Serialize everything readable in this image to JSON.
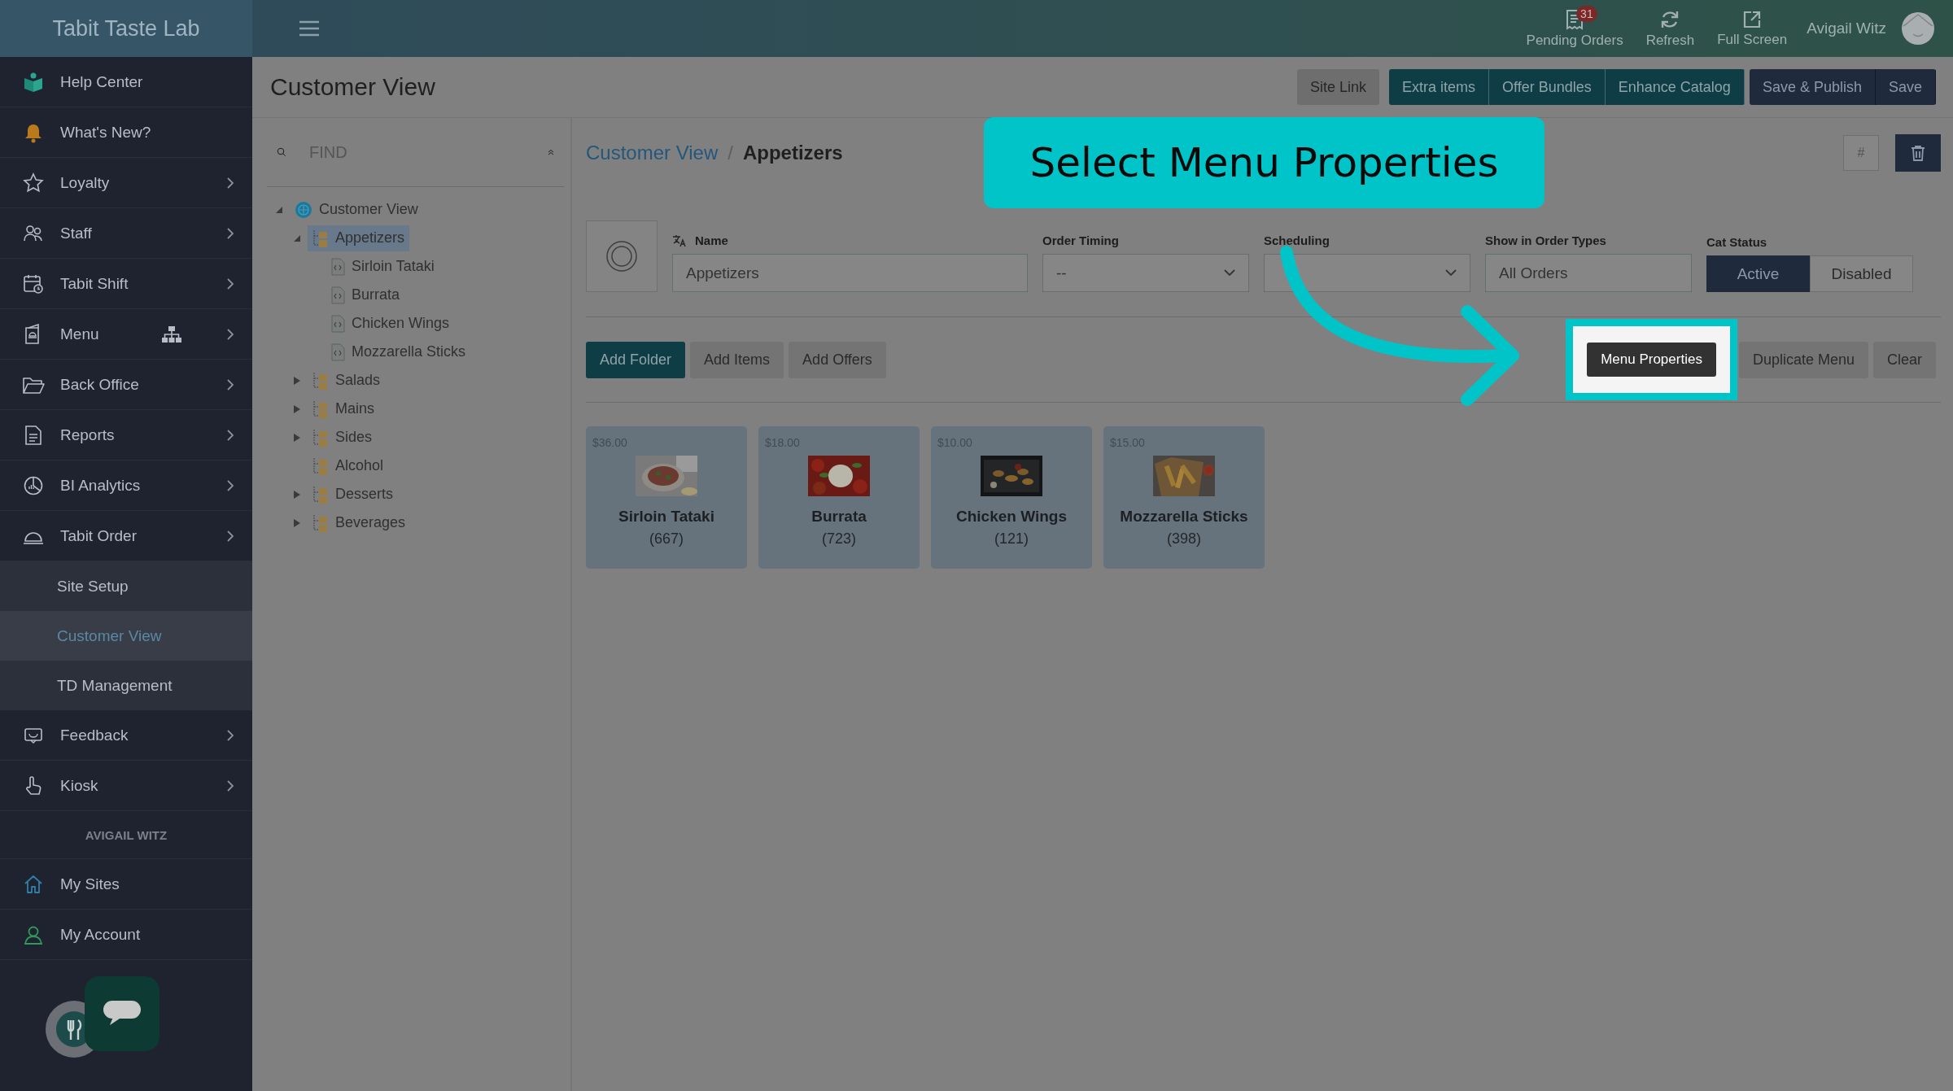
{
  "app": {
    "title": "Tabit Taste Lab"
  },
  "sidebar": {
    "items": [
      {
        "kind": "item",
        "label": "Help Center",
        "submenu": false
      },
      {
        "kind": "item",
        "label": "What's New?",
        "submenu": false
      },
      {
        "kind": "item",
        "label": "Loyalty",
        "submenu": true
      },
      {
        "kind": "item",
        "label": "Staff",
        "submenu": true
      },
      {
        "kind": "item",
        "label": "Tabit Shift",
        "submenu": true
      },
      {
        "kind": "item",
        "label": "Menu",
        "submenu": true
      },
      {
        "kind": "item",
        "label": "Back Office",
        "submenu": true
      },
      {
        "kind": "item",
        "label": "Reports",
        "submenu": true
      },
      {
        "kind": "item",
        "label": "BI Analytics",
        "submenu": true
      },
      {
        "kind": "item",
        "label": "Tabit Order",
        "submenu": true
      },
      {
        "kind": "subitem",
        "label": "Site Setup",
        "selected": false
      },
      {
        "kind": "subitem",
        "label": "Customer View",
        "selected": true
      },
      {
        "kind": "subitem",
        "label": "TD Management",
        "selected": false
      },
      {
        "kind": "item",
        "label": "Feedback",
        "submenu": true
      },
      {
        "kind": "item",
        "label": "Kiosk",
        "submenu": true
      },
      {
        "kind": "heading",
        "label": "AVIGAIL WITZ"
      },
      {
        "kind": "item",
        "label": "My Sites",
        "submenu": false
      },
      {
        "kind": "item",
        "label": "My Account",
        "submenu": false
      }
    ]
  },
  "topbar": {
    "actions": [
      {
        "label": "Pending Orders",
        "badge": "31"
      },
      {
        "label": "Refresh"
      },
      {
        "label": "Full Screen"
      }
    ],
    "user": "Avigail Witz"
  },
  "header": {
    "title": "Customer View",
    "buttons": [
      {
        "label": "Site Link",
        "kind": "plain"
      },
      {
        "label": "Extra items",
        "kind": "teal"
      },
      {
        "label": "Offer Bundles",
        "kind": "teal"
      },
      {
        "label": "Enhance Catalog",
        "kind": "teal"
      },
      {
        "label": "Save & Publish",
        "kind": "dark"
      },
      {
        "label": "Save",
        "kind": "dark"
      }
    ]
  },
  "tree": {
    "placeholder": "FIND",
    "nodes": [
      {
        "kind": "root",
        "label": "Customer View",
        "expanded": true,
        "selected": false,
        "children": [
          {
            "kind": "folder",
            "label": "Appetizers",
            "expanded": true,
            "selected": true,
            "children": [
              {
                "kind": "item",
                "label": "Sirloin Tataki",
                "selected": false
              },
              {
                "kind": "item",
                "label": "Burrata",
                "selected": false
              },
              {
                "kind": "item",
                "label": "Chicken Wings",
                "selected": false
              },
              {
                "kind": "item",
                "label": "Mozzarella Sticks",
                "selected": false
              }
            ]
          },
          {
            "kind": "folder",
            "label": "Salads",
            "expanded": false,
            "selected": false
          },
          {
            "kind": "folder",
            "label": "Mains",
            "expanded": false,
            "selected": false
          },
          {
            "kind": "folder",
            "label": "Sides",
            "expanded": false,
            "selected": false
          },
          {
            "kind": "folder",
            "label": "Alcohol",
            "selected": false
          },
          {
            "kind": "folder",
            "label": "Desserts",
            "expanded": false,
            "selected": false
          },
          {
            "kind": "folder",
            "label": "Beverages",
            "expanded": false,
            "selected": false
          }
        ]
      }
    ]
  },
  "breadcrumb": {
    "items": [
      "Customer View",
      "Appetizers"
    ],
    "separator": "/"
  },
  "hash_button": "#",
  "form": {
    "fields": [
      {
        "kind": "text",
        "label": "Name",
        "value": "Appetizers"
      },
      {
        "kind": "select",
        "label": "Order Timing",
        "value": "--"
      },
      {
        "kind": "select",
        "label": "Scheduling"
      },
      {
        "kind": "text",
        "label": "Show in Order Types",
        "value": "All Orders"
      },
      {
        "kind": "toggle",
        "label": "Cat Status",
        "options": [
          {
            "label": "Active",
            "selected": true
          },
          {
            "label": "Disabled",
            "selected": false
          }
        ]
      }
    ]
  },
  "actions_left": [
    {
      "label": "Add Folder",
      "kind": "primary"
    },
    {
      "label": "Add Items",
      "kind": "plain"
    },
    {
      "label": "Add Offers",
      "kind": "plain"
    }
  ],
  "actions_right": [
    {
      "label": "Menu Properties",
      "kind": "highlighted"
    },
    {
      "label": "Duplicate Menu",
      "kind": "plain"
    },
    {
      "label": "Clear",
      "kind": "plain"
    }
  ],
  "items": [
    {
      "price": "$36.00",
      "name": "Sirloin Tataki",
      "count": "(667)"
    },
    {
      "price": "$18.00",
      "name": "Burrata",
      "count": "(723)"
    },
    {
      "price": "$10.00",
      "name": "Chicken Wings",
      "count": "(121)"
    },
    {
      "price": "$15.00",
      "name": "Mozzarella Sticks",
      "count": "(398)"
    }
  ],
  "callout": {
    "text": "Select Menu Properties"
  }
}
